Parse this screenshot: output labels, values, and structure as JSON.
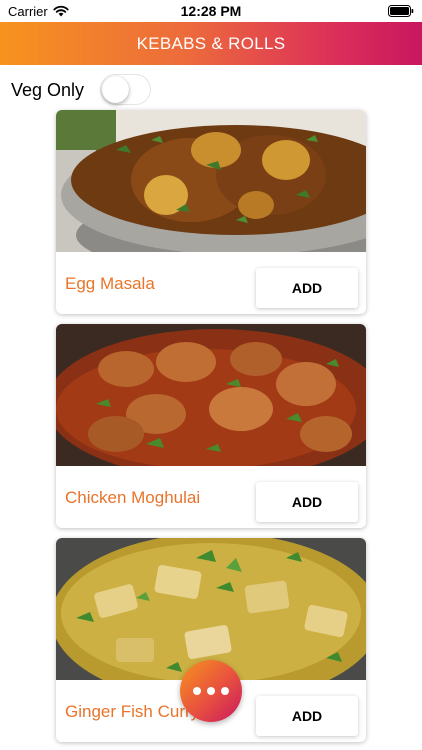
{
  "status_bar": {
    "carrier": "Carrier",
    "time": "12:28 PM",
    "wifi_icon": "wifi-icon",
    "battery_icon": "battery-icon"
  },
  "nav": {
    "title": "KEBABS & ROLLS",
    "gradient_colors": [
      "#f7931e",
      "#dc2e5a",
      "#c8175f"
    ]
  },
  "filter": {
    "veg_only_label": "Veg Only",
    "veg_only_on": false
  },
  "dishes": [
    {
      "name": "Egg Masala",
      "add_label": "ADD"
    },
    {
      "name": "Chicken Moghulai",
      "add_label": "ADD"
    },
    {
      "name": "Ginger Fish Curry",
      "add_label": "ADD"
    }
  ],
  "colors": {
    "dish_name": "#e8742a",
    "fab_gradient": [
      "#f7931e",
      "#c8175f"
    ]
  },
  "fab": {
    "icon": "more-dots-icon"
  }
}
